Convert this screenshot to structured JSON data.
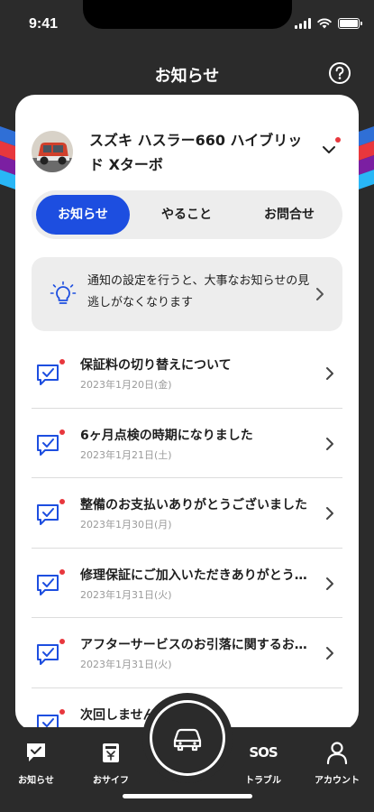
{
  "status_bar": {
    "time": "9:41"
  },
  "header": {
    "title": "お知らせ",
    "help_icon": "question-circle-icon"
  },
  "vehicle": {
    "name": "スズキ ハスラー660 ハイブリッド Xターボ",
    "has_unread": true
  },
  "tabs": [
    {
      "label": "お知らせ",
      "active": true
    },
    {
      "label": "やること",
      "active": false
    },
    {
      "label": "お問合せ",
      "active": false
    }
  ],
  "hint": {
    "icon": "lightbulb-icon",
    "text": "通知の設定を行うと、大事なお知らせの見逃しがなくなります"
  },
  "notifications": [
    {
      "title": "保証料の切り替えについて",
      "date": "2023年1月20日(金)",
      "unread": true
    },
    {
      "title": "6ヶ月点検の時期になりました",
      "date": "2023年1月21日(土)",
      "unread": true
    },
    {
      "title": "整備のお支払いありがとうございました",
      "date": "2023年1月30日(月)",
      "unread": true
    },
    {
      "title": "修理保証にご加入いただきありがとうございます",
      "date": "2023年1月31日(火)",
      "unread": true
    },
    {
      "title": "アフターサービスのお引落に関するお知らせ",
      "date": "2023年1月31日(火)",
      "unread": true
    },
    {
      "title": "次回しませんか",
      "date": "",
      "unread": true
    }
  ],
  "bottom_nav": {
    "items": [
      {
        "label": "お知らせ",
        "icon": "notification-icon"
      },
      {
        "label": "おサイフ",
        "icon": "wallet-icon"
      },
      {
        "label": "トラブル",
        "icon": "sos-icon"
      },
      {
        "label": "アカウント",
        "icon": "account-icon"
      }
    ],
    "center_icon": "car-icon",
    "sos_text": "SOS"
  },
  "colors": {
    "accent": "#1d4ee0",
    "unread_dot": "#e8373d",
    "background": "#2b2b2b"
  }
}
